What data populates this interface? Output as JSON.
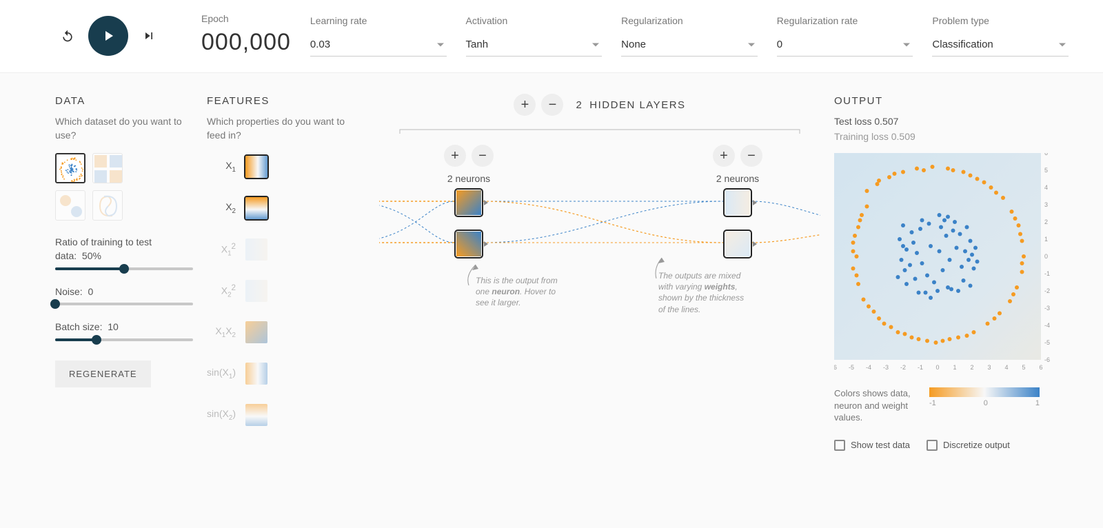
{
  "topbar": {
    "epoch_label": "Epoch",
    "epoch_value": "000,000",
    "learning_rate": {
      "label": "Learning rate",
      "value": "0.03"
    },
    "activation": {
      "label": "Activation",
      "value": "Tanh"
    },
    "regularization": {
      "label": "Regularization",
      "value": "None"
    },
    "regularization_rate": {
      "label": "Regularization rate",
      "value": "0"
    },
    "problem_type": {
      "label": "Problem type",
      "value": "Classification"
    }
  },
  "data": {
    "heading": "DATA",
    "desc": "Which dataset do you want to use?",
    "datasets": [
      "circle",
      "xor",
      "gauss",
      "spiral"
    ],
    "selected_dataset": "circle",
    "ratio": {
      "label": "Ratio of training to test data:",
      "value": "50%",
      "pct": 50
    },
    "noise": {
      "label": "Noise:",
      "value": "0",
      "pct": 0
    },
    "batch": {
      "label": "Batch size:",
      "value": "10",
      "pct": 30
    },
    "regenerate": "REGENERATE"
  },
  "features": {
    "heading": "FEATURES",
    "desc": "Which properties do you want to feed in?",
    "items": [
      {
        "id": "x1",
        "label_html": "X<sub>1</sub>",
        "active": true
      },
      {
        "id": "x2",
        "label_html": "X<sub>2</sub>",
        "active": true
      },
      {
        "id": "x1sq",
        "label_html": "X<sub>1</sub><sup>2</sup>",
        "active": false
      },
      {
        "id": "x2sq",
        "label_html": "X<sub>2</sub><sup>2</sup>",
        "active": false
      },
      {
        "id": "x1x2",
        "label_html": "X<sub>1</sub>X<sub>2</sub>",
        "active": false
      },
      {
        "id": "sinx1",
        "label_html": "sin(X<sub>1</sub>)",
        "active": false
      },
      {
        "id": "sinx2",
        "label_html": "sin(X<sub>2</sub>)",
        "active": false
      }
    ]
  },
  "network": {
    "hidden_layers_label": "HIDDEN LAYERS",
    "hidden_layers_count": "2",
    "layers": [
      {
        "neurons_label": "2 neurons"
      },
      {
        "neurons_label": "2 neurons"
      }
    ],
    "callout_neuron": "This is the output from one neuron. Hover to see it larger.",
    "callout_weights": "The outputs are mixed with varying weights, shown by the thickness of the lines."
  },
  "output": {
    "heading": "OUTPUT",
    "test_loss_label": "Test loss",
    "test_loss_value": "0.507",
    "train_loss_label": "Training loss",
    "train_loss_value": "0.509",
    "axis_ticks": [
      "-6",
      "-5",
      "-4",
      "-3",
      "-2",
      "-1",
      "0",
      "1",
      "2",
      "3",
      "4",
      "5",
      "6"
    ],
    "legend_text": "Colors shows data, neuron and weight values.",
    "gradient_min": "-1",
    "gradient_mid": "0",
    "gradient_max": "1",
    "show_test_label": "Show test data",
    "discretize_label": "Discretize output"
  },
  "colors": {
    "orange": "#f59b22",
    "blue": "#3b82c7",
    "accent": "#183d4e"
  },
  "chart_data": {
    "type": "scatter",
    "title": "",
    "xlabel": "",
    "ylabel": "",
    "xlim": [
      -6,
      6
    ],
    "ylim": [
      -6,
      6
    ],
    "series": [
      {
        "name": "class_orange",
        "color": "#f59b22",
        "points": [
          [
            -4.1,
            3.8
          ],
          [
            -3.5,
            4.2
          ],
          [
            -2.8,
            4.6
          ],
          [
            -2.0,
            4.9
          ],
          [
            -1.2,
            5.1
          ],
          [
            -0.3,
            5.2
          ],
          [
            0.6,
            5.1
          ],
          [
            1.5,
            4.9
          ],
          [
            2.3,
            4.5
          ],
          [
            3.1,
            4.0
          ],
          [
            3.8,
            3.4
          ],
          [
            4.3,
            2.6
          ],
          [
            4.7,
            1.8
          ],
          [
            4.9,
            0.9
          ],
          [
            5.0,
            0.0
          ],
          [
            4.9,
            -0.9
          ],
          [
            4.6,
            -1.8
          ],
          [
            4.2,
            -2.6
          ],
          [
            3.6,
            -3.3
          ],
          [
            2.9,
            -3.9
          ],
          [
            2.1,
            -4.4
          ],
          [
            1.2,
            -4.7
          ],
          [
            0.3,
            -4.9
          ],
          [
            -0.6,
            -4.9
          ],
          [
            -1.5,
            -4.7
          ],
          [
            -2.3,
            -4.4
          ],
          [
            -3.1,
            -3.9
          ],
          [
            -3.7,
            -3.2
          ],
          [
            -4.3,
            -2.5
          ],
          [
            -4.6,
            -1.6
          ],
          [
            -4.9,
            -0.7
          ],
          [
            -4.9,
            0.3
          ],
          [
            -4.8,
            1.2
          ],
          [
            -4.5,
            2.1
          ],
          [
            -4.1,
            2.9
          ],
          [
            -3.4,
            4.4
          ],
          [
            -2.5,
            4.8
          ],
          [
            -0.8,
            5.0
          ],
          [
            0.9,
            5.0
          ],
          [
            1.9,
            4.7
          ],
          [
            2.7,
            4.3
          ],
          [
            3.4,
            3.7
          ],
          [
            -4.4,
            2.4
          ],
          [
            4.5,
            2.2
          ],
          [
            4.8,
            1.3
          ],
          [
            4.9,
            -0.4
          ],
          [
            4.4,
            -2.2
          ],
          [
            3.3,
            -3.6
          ],
          [
            -2.7,
            -4.1
          ],
          [
            -3.4,
            -3.6
          ],
          [
            -4.0,
            -2.9
          ],
          [
            -4.7,
            -1.1
          ],
          [
            -4.9,
            0.8
          ],
          [
            -4.6,
            1.7
          ],
          [
            -0.1,
            -5.0
          ],
          [
            1.7,
            -4.6
          ],
          [
            0.7,
            -4.8
          ],
          [
            -1.1,
            -4.8
          ],
          [
            -1.9,
            -4.5
          ],
          [
            -4.7,
            0.0
          ]
        ]
      },
      {
        "name": "class_blue",
        "color": "#3b82c7",
        "points": [
          [
            0.1,
            0.3
          ],
          [
            -0.4,
            0.6
          ],
          [
            0.7,
            -0.2
          ],
          [
            -0.9,
            -0.4
          ],
          [
            0.3,
            -0.8
          ],
          [
            1.1,
            0.5
          ],
          [
            -1.2,
            0.2
          ],
          [
            0.5,
            1.2
          ],
          [
            -0.6,
            -1.1
          ],
          [
            1.4,
            -0.6
          ],
          [
            -1.4,
            0.8
          ],
          [
            0.9,
            1.5
          ],
          [
            -0.2,
            -1.5
          ],
          [
            1.6,
            0.3
          ],
          [
            -1.6,
            -0.5
          ],
          [
            0.2,
            1.7
          ],
          [
            1.8,
            -0.2
          ],
          [
            -1.0,
            1.6
          ],
          [
            -1.8,
            0.4
          ],
          [
            0.6,
            -1.8
          ],
          [
            1.3,
            1.3
          ],
          [
            -1.3,
            -1.3
          ],
          [
            1.9,
            0.9
          ],
          [
            -0.5,
            1.9
          ],
          [
            -1.9,
            -0.8
          ],
          [
            0.8,
            -1.9
          ],
          [
            2.0,
            0.1
          ],
          [
            -2.0,
            0.6
          ],
          [
            0.0,
            -2.0
          ],
          [
            1.5,
            -1.4
          ],
          [
            -1.5,
            1.4
          ],
          [
            2.1,
            -0.7
          ],
          [
            -0.7,
            -2.1
          ],
          [
            1.0,
            2.0
          ],
          [
            -2.1,
            -0.2
          ],
          [
            0.4,
            2.1
          ],
          [
            1.7,
            1.7
          ],
          [
            -1.8,
            -1.6
          ],
          [
            2.2,
            0.5
          ],
          [
            -0.9,
            2.1
          ],
          [
            -2.2,
            1.0
          ],
          [
            1.2,
            -2.0
          ],
          [
            -1.1,
            -2.1
          ],
          [
            2.3,
            -0.3
          ],
          [
            0.1,
            2.4
          ],
          [
            -2.3,
            -1.2
          ],
          [
            1.9,
            -1.7
          ],
          [
            -2.0,
            1.8
          ],
          [
            0.6,
            2.3
          ],
          [
            -0.4,
            -2.4
          ]
        ]
      }
    ]
  }
}
